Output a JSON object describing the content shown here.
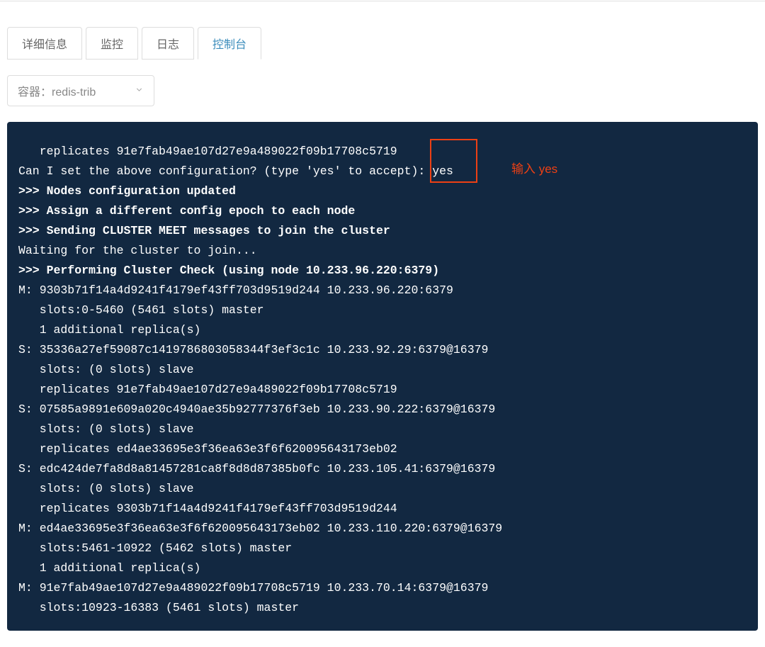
{
  "tabs": {
    "detail": "详细信息",
    "monitor": "监控",
    "log": "日志",
    "console": "控制台"
  },
  "dropdown": {
    "label": "容器：redis-trib"
  },
  "annotation": "输入 yes",
  "consoleLines": [
    {
      "text": "   replicates 91e7fab49ae107d27e9a489022f09b17708c5719",
      "bold": false
    },
    {
      "text": "Can I set the above configuration? (type 'yes' to accept): yes",
      "bold": false
    },
    {
      "text": ">>> Nodes configuration updated",
      "bold": true
    },
    {
      "text": ">>> Assign a different config epoch to each node",
      "bold": true
    },
    {
      "text": ">>> Sending CLUSTER MEET messages to join the cluster",
      "bold": true
    },
    {
      "text": "Waiting for the cluster to join...",
      "bold": false
    },
    {
      "text": ">>> Performing Cluster Check (using node 10.233.96.220:6379)",
      "bold": true
    },
    {
      "text": "M: 9303b71f14a4d9241f4179ef43ff703d9519d244 10.233.96.220:6379",
      "bold": false
    },
    {
      "text": "   slots:0-5460 (5461 slots) master",
      "bold": false
    },
    {
      "text": "   1 additional replica(s)",
      "bold": false
    },
    {
      "text": "S: 35336a27ef59087c1419786803058344f3ef3c1c 10.233.92.29:6379@16379",
      "bold": false
    },
    {
      "text": "   slots: (0 slots) slave",
      "bold": false
    },
    {
      "text": "   replicates 91e7fab49ae107d27e9a489022f09b17708c5719",
      "bold": false
    },
    {
      "text": "S: 07585a9891e609a020c4940ae35b92777376f3eb 10.233.90.222:6379@16379",
      "bold": false
    },
    {
      "text": "   slots: (0 slots) slave",
      "bold": false
    },
    {
      "text": "   replicates ed4ae33695e3f36ea63e3f6f620095643173eb02",
      "bold": false
    },
    {
      "text": "S: edc424de7fa8d8a81457281ca8f8d8d87385b0fc 10.233.105.41:6379@16379",
      "bold": false
    },
    {
      "text": "   slots: (0 slots) slave",
      "bold": false
    },
    {
      "text": "   replicates 9303b71f14a4d9241f4179ef43ff703d9519d244",
      "bold": false
    },
    {
      "text": "M: ed4ae33695e3f36ea63e3f6f620095643173eb02 10.233.110.220:6379@16379",
      "bold": false
    },
    {
      "text": "   slots:5461-10922 (5462 slots) master",
      "bold": false
    },
    {
      "text": "   1 additional replica(s)",
      "bold": false
    },
    {
      "text": "M: 91e7fab49ae107d27e9a489022f09b17708c5719 10.233.70.14:6379@16379",
      "bold": false
    },
    {
      "text": "   slots:10923-16383 (5461 slots) master",
      "bold": false
    }
  ]
}
